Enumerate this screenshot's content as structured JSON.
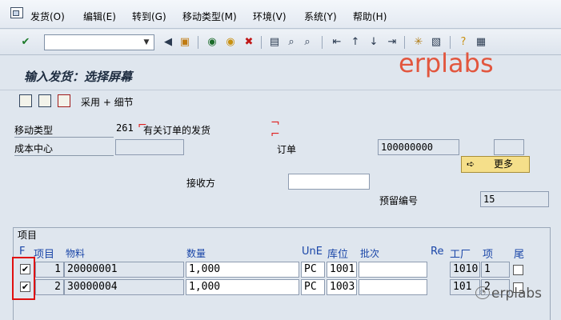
{
  "menu": {
    "items": [
      "发货(O)",
      "编辑(E)",
      "转到(G)",
      "移动类型(M)",
      "环境(V)",
      "系统(Y)",
      "帮助(H)"
    ]
  },
  "toolbar": {
    "command_value": "",
    "icons": [
      "check-icon",
      "back-icon",
      "save-icon",
      "green-back-icon",
      "exit-icon",
      "cancel-icon",
      "print-icon",
      "find-icon",
      "find-next-icon",
      "first-page-icon",
      "prev-page-icon",
      "next-page-icon",
      "last-page-icon",
      "new-session-icon",
      "shortcut-icon",
      "help-icon",
      "layout-icon"
    ]
  },
  "title": "输入发货：选择屏幕",
  "watermark": "erplabs",
  "app_toolbar": {
    "adopt_label": "采用 + 细节"
  },
  "header": {
    "movement_type_label": "移动类型",
    "movement_type_value": "261",
    "movement_type_desc": "有关订单的发货",
    "cost_center_label": "成本中心",
    "cost_center_value": "",
    "order_label": "订单",
    "order_value": "100000000",
    "order_extra_value": "",
    "more_button_label": "更多",
    "recipient_label": "接收方",
    "recipient_value": "",
    "reservation_label": "预留编号",
    "reservation_value": "15"
  },
  "items": {
    "group_title": "项目",
    "columns": {
      "flag": "F",
      "item": "项目",
      "material": "物料",
      "quantity": "数量",
      "unit": "UnE",
      "storage": "库位",
      "batch": "批次",
      "re": "Re",
      "plant": "工厂",
      "line": "项",
      "final": "尾"
    },
    "rows": [
      {
        "checked": true,
        "item": "1",
        "material": "20000001",
        "quantity": "1,000",
        "unit": "PC",
        "storage": "1001",
        "batch": "",
        "plant": "1010",
        "line": "1",
        "final": false
      },
      {
        "checked": true,
        "item": "2",
        "material": "30000004",
        "quantity": "1,000",
        "unit": "PC",
        "storage": "1003",
        "batch": "",
        "plant": "101",
        "line": "2",
        "final": false
      }
    ]
  },
  "watermark_bottom": "erplabs"
}
